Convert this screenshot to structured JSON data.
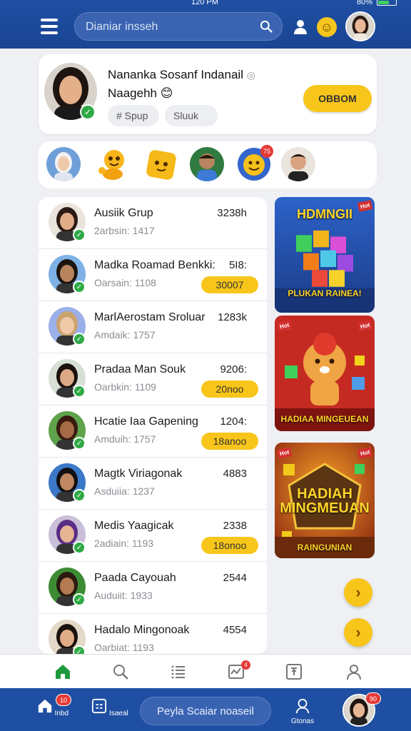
{
  "status": {
    "time": "120 PM",
    "battery": "80%"
  },
  "header": {
    "search_placeholder": "Dianiar insseh"
  },
  "profile": {
    "name": "Nananka Sosanf Indanail",
    "subtitle": "Naagehh",
    "chips": [
      "# Spup",
      "Sluuk"
    ],
    "join_label": "OBBOM"
  },
  "stories": {
    "badge": "75"
  },
  "list": [
    {
      "name": "Ausiik Grup",
      "sub": "2arbsin: 1417",
      "value": "3238h",
      "pill": ""
    },
    {
      "name": "Madka Roamad Benkki:",
      "sub": "Oarsain: 1108",
      "value": "5I8:",
      "pill": "30007"
    },
    {
      "name": "MarlAerostam Sroluar",
      "sub": "Amdaik: 1757",
      "value": "1283k",
      "pill": ""
    },
    {
      "name": "Pradaa Man Souk",
      "sub": "Oarbkin: 1109",
      "value": "9206:",
      "pill": "20noo"
    },
    {
      "name": "Hcatie Iaa Gapening",
      "sub": "Amduih: 1757",
      "value": "1204:",
      "pill": "18anoo"
    },
    {
      "name": "Magtk Viriagonak",
      "sub": "Asduiia: 1237",
      "value": "4883",
      "pill": ""
    },
    {
      "name": "Medis Yaagicak",
      "sub": "2adiain: 1193",
      "value": "2338",
      "pill": "18onoo"
    },
    {
      "name": "Paada Cayouah",
      "sub": "Auduiit: 1933",
      "value": "2544",
      "pill": ""
    },
    {
      "name": "Hadalo Mingonoak",
      "sub": "Oarbiat: 1193",
      "value": "4554",
      "pill": ""
    }
  ],
  "promos": [
    {
      "title": "HDMNGII",
      "caption": "PLUKAN RAINEA!",
      "tag": "Hot"
    },
    {
      "title": "",
      "caption": "HADIAA MINGEUEAN",
      "tag": "Hot"
    },
    {
      "title": "HADIAH MINGMEUAN",
      "caption": "RAINGUNIAN",
      "tag": "Hot"
    }
  ],
  "tabbar": {
    "notif_badge": "4"
  },
  "bottomnav": {
    "home_label": "Inbd",
    "home_badge": "10",
    "feed_label": "Isaeal",
    "search_label": "Peyla Scaiar noaseil",
    "groups_label": "Gtonas",
    "avatar_badge": "90"
  },
  "colors": {
    "primary": "#1f4fa3",
    "accent": "#f8c51a",
    "verified": "#2fa946",
    "badge": "#e53935"
  }
}
